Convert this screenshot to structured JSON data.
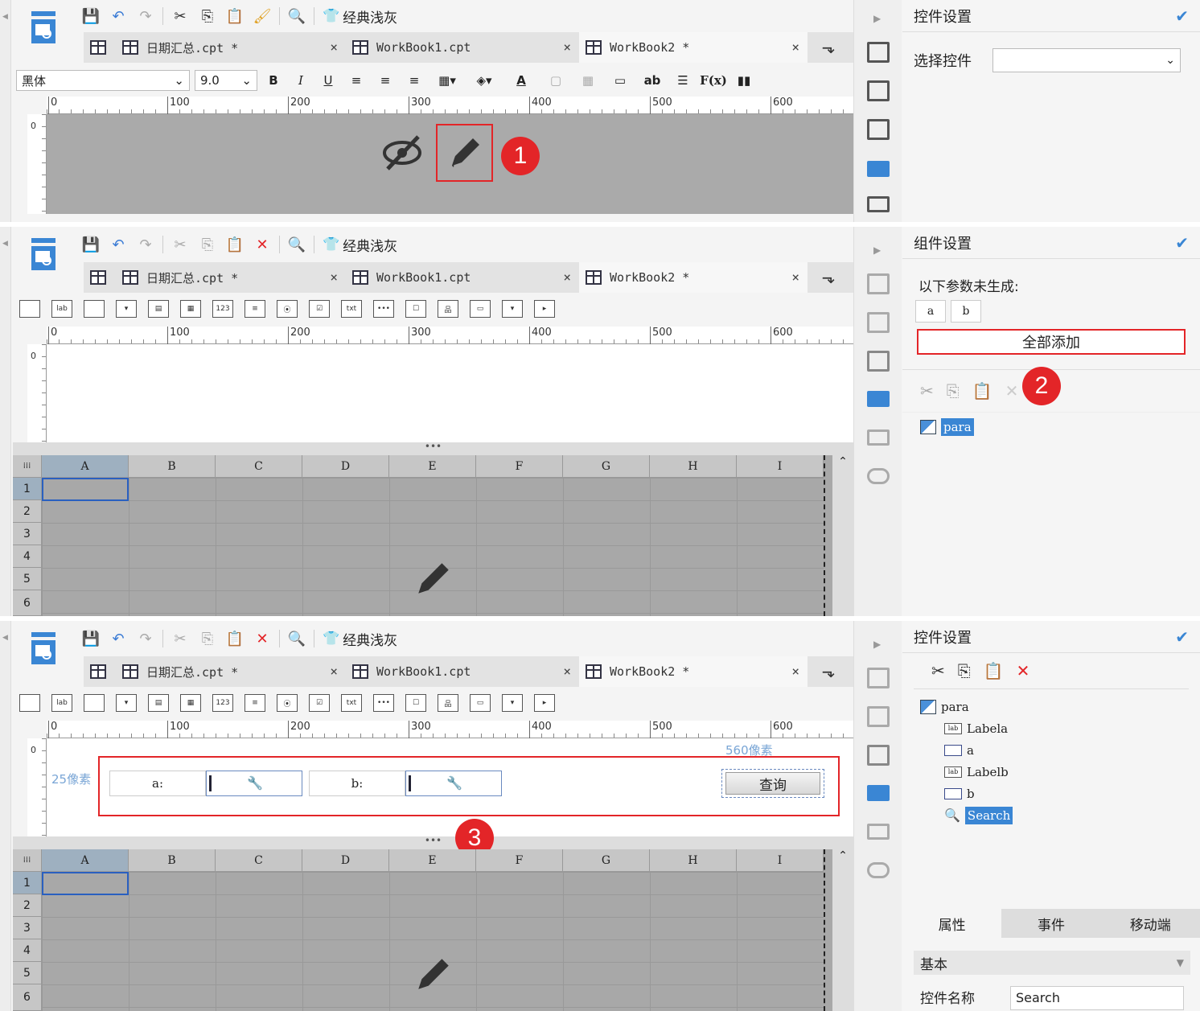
{
  "toolbar": {
    "theme_label": "经典浅灰"
  },
  "tabs": [
    "日期汇总.cpt *",
    "WorkBook1.cpt",
    "WorkBook2 *"
  ],
  "tab_close": "×",
  "font": {
    "family": "黑体",
    "size": "9.0"
  },
  "format_buttons": {
    "bold": "B",
    "italic": "I",
    "underline": "U",
    "text_color": "A",
    "ab": "ab",
    "fx": "F(x)"
  },
  "ruler_ticks": [
    "0",
    "100",
    "200",
    "300",
    "400",
    "500",
    "600"
  ],
  "vruler_tick": "0",
  "panel1": {
    "title": "控件设置",
    "select_label": "选择控件",
    "select_value": ""
  },
  "panel2": {
    "title": "组件设置",
    "notice": "以下参数未生成:",
    "params": [
      "a",
      "b"
    ],
    "add_all": "全部添加",
    "tree_root": "para"
  },
  "panel3": {
    "title": "控件设置",
    "tree": [
      "para",
      "Labela",
      "a",
      "Labelb",
      "b",
      "Search"
    ],
    "tabs": [
      "属性",
      "事件",
      "移动端"
    ],
    "section": "基本",
    "name_label": "控件名称",
    "name_value": "Search"
  },
  "widget_labels": {
    "a": "a:",
    "b": "b:",
    "query": "查询"
  },
  "annotations": {
    "px25": "25像素",
    "px560": "560像素"
  },
  "grid": {
    "columns": [
      "A",
      "B",
      "C",
      "D",
      "E",
      "F",
      "G",
      "H",
      "I"
    ],
    "rows": [
      "1",
      "2",
      "3",
      "4",
      "5",
      "6"
    ]
  },
  "badges": [
    "1",
    "2",
    "3"
  ],
  "colors": {
    "accent": "#3a86d4",
    "highlight": "#e32528"
  }
}
